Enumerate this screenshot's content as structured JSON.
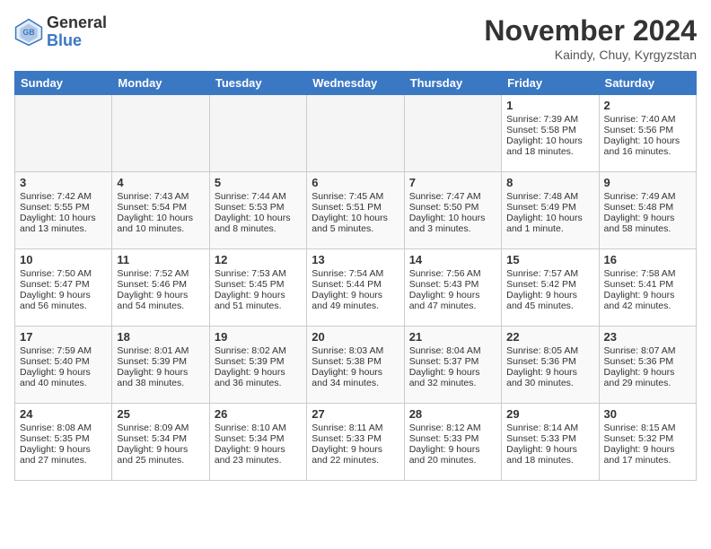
{
  "header": {
    "logo_line1": "General",
    "logo_line2": "Blue",
    "month": "November 2024",
    "location": "Kaindy, Chuy, Kyrgyzstan"
  },
  "days_of_week": [
    "Sunday",
    "Monday",
    "Tuesday",
    "Wednesday",
    "Thursday",
    "Friday",
    "Saturday"
  ],
  "weeks": [
    [
      {
        "day": "",
        "empty": true
      },
      {
        "day": "",
        "empty": true
      },
      {
        "day": "",
        "empty": true
      },
      {
        "day": "",
        "empty": true
      },
      {
        "day": "",
        "empty": true
      },
      {
        "day": "1",
        "lines": [
          "Sunrise: 7:39 AM",
          "Sunset: 5:58 PM",
          "Daylight: 10 hours",
          "and 18 minutes."
        ]
      },
      {
        "day": "2",
        "lines": [
          "Sunrise: 7:40 AM",
          "Sunset: 5:56 PM",
          "Daylight: 10 hours",
          "and 16 minutes."
        ]
      }
    ],
    [
      {
        "day": "3",
        "lines": [
          "Sunrise: 7:42 AM",
          "Sunset: 5:55 PM",
          "Daylight: 10 hours",
          "and 13 minutes."
        ]
      },
      {
        "day": "4",
        "lines": [
          "Sunrise: 7:43 AM",
          "Sunset: 5:54 PM",
          "Daylight: 10 hours",
          "and 10 minutes."
        ]
      },
      {
        "day": "5",
        "lines": [
          "Sunrise: 7:44 AM",
          "Sunset: 5:53 PM",
          "Daylight: 10 hours",
          "and 8 minutes."
        ]
      },
      {
        "day": "6",
        "lines": [
          "Sunrise: 7:45 AM",
          "Sunset: 5:51 PM",
          "Daylight: 10 hours",
          "and 5 minutes."
        ]
      },
      {
        "day": "7",
        "lines": [
          "Sunrise: 7:47 AM",
          "Sunset: 5:50 PM",
          "Daylight: 10 hours",
          "and 3 minutes."
        ]
      },
      {
        "day": "8",
        "lines": [
          "Sunrise: 7:48 AM",
          "Sunset: 5:49 PM",
          "Daylight: 10 hours",
          "and 1 minute."
        ]
      },
      {
        "day": "9",
        "lines": [
          "Sunrise: 7:49 AM",
          "Sunset: 5:48 PM",
          "Daylight: 9 hours",
          "and 58 minutes."
        ]
      }
    ],
    [
      {
        "day": "10",
        "lines": [
          "Sunrise: 7:50 AM",
          "Sunset: 5:47 PM",
          "Daylight: 9 hours",
          "and 56 minutes."
        ]
      },
      {
        "day": "11",
        "lines": [
          "Sunrise: 7:52 AM",
          "Sunset: 5:46 PM",
          "Daylight: 9 hours",
          "and 54 minutes."
        ]
      },
      {
        "day": "12",
        "lines": [
          "Sunrise: 7:53 AM",
          "Sunset: 5:45 PM",
          "Daylight: 9 hours",
          "and 51 minutes."
        ]
      },
      {
        "day": "13",
        "lines": [
          "Sunrise: 7:54 AM",
          "Sunset: 5:44 PM",
          "Daylight: 9 hours",
          "and 49 minutes."
        ]
      },
      {
        "day": "14",
        "lines": [
          "Sunrise: 7:56 AM",
          "Sunset: 5:43 PM",
          "Daylight: 9 hours",
          "and 47 minutes."
        ]
      },
      {
        "day": "15",
        "lines": [
          "Sunrise: 7:57 AM",
          "Sunset: 5:42 PM",
          "Daylight: 9 hours",
          "and 45 minutes."
        ]
      },
      {
        "day": "16",
        "lines": [
          "Sunrise: 7:58 AM",
          "Sunset: 5:41 PM",
          "Daylight: 9 hours",
          "and 42 minutes."
        ]
      }
    ],
    [
      {
        "day": "17",
        "lines": [
          "Sunrise: 7:59 AM",
          "Sunset: 5:40 PM",
          "Daylight: 9 hours",
          "and 40 minutes."
        ]
      },
      {
        "day": "18",
        "lines": [
          "Sunrise: 8:01 AM",
          "Sunset: 5:39 PM",
          "Daylight: 9 hours",
          "and 38 minutes."
        ]
      },
      {
        "day": "19",
        "lines": [
          "Sunrise: 8:02 AM",
          "Sunset: 5:39 PM",
          "Daylight: 9 hours",
          "and 36 minutes."
        ]
      },
      {
        "day": "20",
        "lines": [
          "Sunrise: 8:03 AM",
          "Sunset: 5:38 PM",
          "Daylight: 9 hours",
          "and 34 minutes."
        ]
      },
      {
        "day": "21",
        "lines": [
          "Sunrise: 8:04 AM",
          "Sunset: 5:37 PM",
          "Daylight: 9 hours",
          "and 32 minutes."
        ]
      },
      {
        "day": "22",
        "lines": [
          "Sunrise: 8:05 AM",
          "Sunset: 5:36 PM",
          "Daylight: 9 hours",
          "and 30 minutes."
        ]
      },
      {
        "day": "23",
        "lines": [
          "Sunrise: 8:07 AM",
          "Sunset: 5:36 PM",
          "Daylight: 9 hours",
          "and 29 minutes."
        ]
      }
    ],
    [
      {
        "day": "24",
        "lines": [
          "Sunrise: 8:08 AM",
          "Sunset: 5:35 PM",
          "Daylight: 9 hours",
          "and 27 minutes."
        ]
      },
      {
        "day": "25",
        "lines": [
          "Sunrise: 8:09 AM",
          "Sunset: 5:34 PM",
          "Daylight: 9 hours",
          "and 25 minutes."
        ]
      },
      {
        "day": "26",
        "lines": [
          "Sunrise: 8:10 AM",
          "Sunset: 5:34 PM",
          "Daylight: 9 hours",
          "and 23 minutes."
        ]
      },
      {
        "day": "27",
        "lines": [
          "Sunrise: 8:11 AM",
          "Sunset: 5:33 PM",
          "Daylight: 9 hours",
          "and 22 minutes."
        ]
      },
      {
        "day": "28",
        "lines": [
          "Sunrise: 8:12 AM",
          "Sunset: 5:33 PM",
          "Daylight: 9 hours",
          "and 20 minutes."
        ]
      },
      {
        "day": "29",
        "lines": [
          "Sunrise: 8:14 AM",
          "Sunset: 5:33 PM",
          "Daylight: 9 hours",
          "and 18 minutes."
        ]
      },
      {
        "day": "30",
        "lines": [
          "Sunrise: 8:15 AM",
          "Sunset: 5:32 PM",
          "Daylight: 9 hours",
          "and 17 minutes."
        ]
      }
    ]
  ]
}
